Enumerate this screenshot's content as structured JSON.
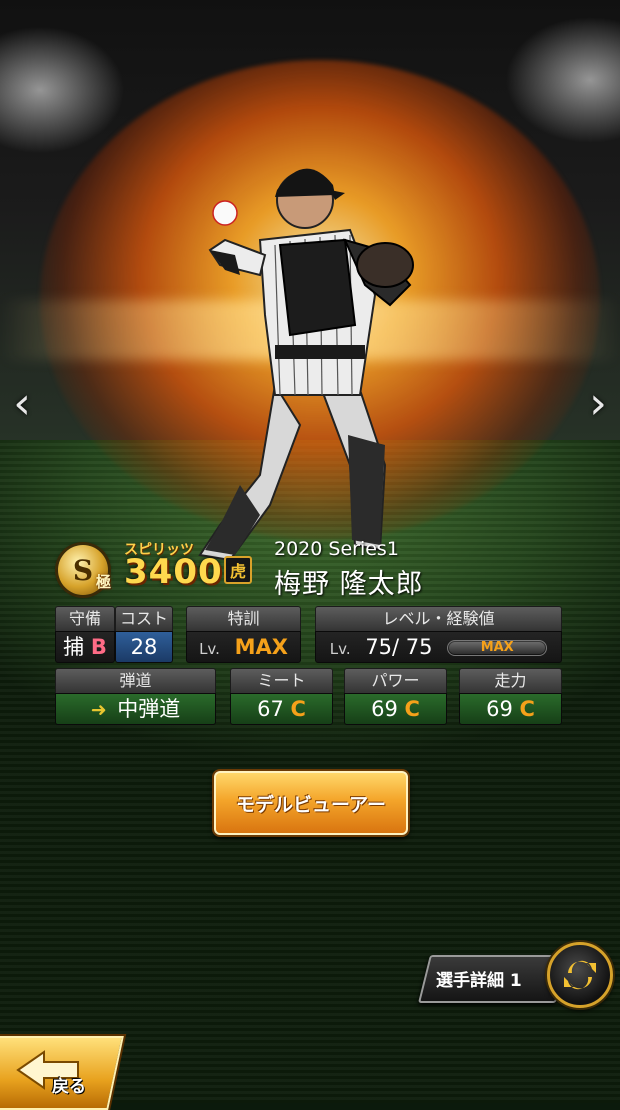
{
  "card": {
    "rank_letter": "S",
    "rank_sub": "極",
    "spirits_label": "スピリッツ",
    "spirits_value": "3400",
    "team_logo": "虎",
    "series": "2020 Series1",
    "player_name": "梅野 隆太郎"
  },
  "stats": {
    "defense": {
      "header": "守備",
      "position": "捕",
      "grade": "B"
    },
    "cost": {
      "header": "コスト",
      "value": "28"
    },
    "training": {
      "header": "特訓",
      "lv": "Lv.",
      "value": "MAX"
    },
    "level": {
      "header": "レベル・経験値",
      "lv": "Lv.",
      "value": "75/ 75",
      "bar_label": "MAX",
      "exp_fraction": 1.0
    },
    "trajectory": {
      "header": "弾道",
      "icon": "arrow-up-right-icon",
      "value": "中弾道"
    },
    "meet": {
      "header": "ミート",
      "value": "67",
      "grade": "C"
    },
    "power": {
      "header": "パワー",
      "value": "69",
      "grade": "C"
    },
    "speed": {
      "header": "走力",
      "value": "69",
      "grade": "C"
    }
  },
  "buttons": {
    "model_viewer": "モデルビューアー",
    "player_detail": "選手詳細 1",
    "back": "戻る"
  },
  "nav": {
    "prev": "‹",
    "next": "›"
  },
  "colors": {
    "accent_orange": "#f5a11a",
    "gold": "#d6a22a",
    "grade_b": "#ff6b86"
  }
}
